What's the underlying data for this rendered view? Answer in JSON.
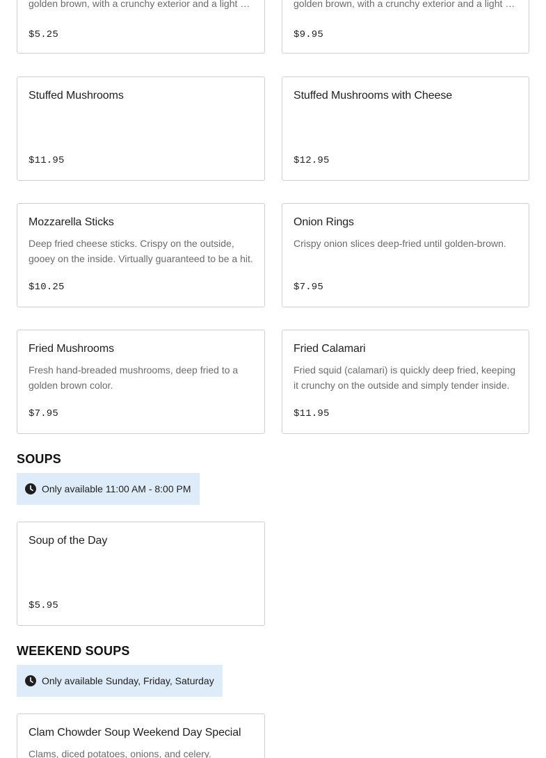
{
  "partial_items": [
    {
      "description": "golden brown, with a crunchy exterior and a light and fluffy interior.",
      "price": "$5.25"
    },
    {
      "description": "golden brown, with a crunchy exterior and a light and fluffy interior.",
      "price": "$9.95"
    }
  ],
  "appetizers": [
    {
      "name": "Stuffed Mushrooms",
      "description": "",
      "price": "$11.95"
    },
    {
      "name": "Stuffed Mushrooms with Cheese",
      "description": "",
      "price": "$12.95"
    },
    {
      "name": "Mozzarella Sticks",
      "description": "Deep fried cheese sticks. Crispy on the outside, gooey on the inside. Virtually guaranteed to be a hit.",
      "price": "$10.25"
    },
    {
      "name": "Onion Rings",
      "description": "Crispy onion slices deep-fried until golden-brown.",
      "price": "$7.95"
    },
    {
      "name": "Fried Mushrooms",
      "description": "Fresh hand-breaded mushrooms, deep fried to a golden brown color.",
      "price": "$7.95"
    },
    {
      "name": "Fried Calamari",
      "description": "Fried squid (calamari) is quickly deep fried, keeping it crunchy on the outside and simply tender inside.",
      "price": "$11.95"
    }
  ],
  "soups": {
    "title": "SOUPS",
    "availability": "Only available 11:00 AM - 8:00 PM",
    "items": [
      {
        "name": "Soup of the Day",
        "description": "",
        "price": "$5.95"
      }
    ]
  },
  "weekend_soups": {
    "title": "WEEKEND SOUPS",
    "availability": "Only available Sunday, Friday, Saturday",
    "items": [
      {
        "name": "Clam Chowder Soup Weekend Day Special",
        "description": "Clams, diced potatoes, onions, and celery."
      }
    ]
  },
  "icons": {
    "availability": "clock-icon"
  },
  "colors": {
    "availability_bg": "#deebf8",
    "card_border": "#cfcfcf",
    "description_text": "#6b6b6b"
  }
}
